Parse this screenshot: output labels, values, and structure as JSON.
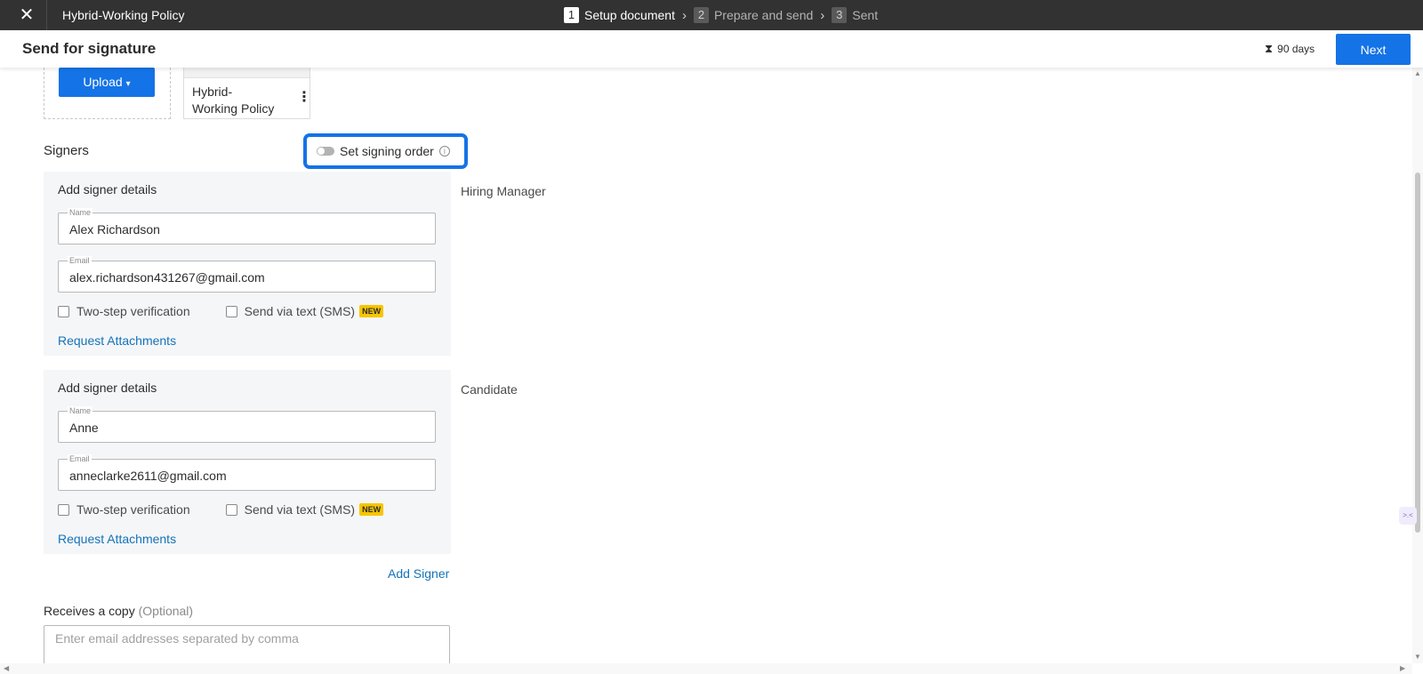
{
  "topbar": {
    "close_icon": "close-icon",
    "document_title": "Hybrid-Working Policy",
    "steps": [
      {
        "number": "1",
        "label": "Setup document",
        "state": "active"
      },
      {
        "number": "2",
        "label": "Prepare and send",
        "state": "inactive"
      },
      {
        "number": "3",
        "label": "Sent",
        "state": "inactive"
      }
    ],
    "chevron": "›"
  },
  "header": {
    "title": "Send for signature",
    "expiry_icon": "hourglass-icon",
    "expiry_text": "90 days",
    "next_label": "Next"
  },
  "upload": {
    "button_label": "Upload",
    "caret": "▾"
  },
  "document_card": {
    "name_line1": "Hybrid-",
    "name_line2": "Working Policy",
    "more_icon": "⋮"
  },
  "signers": {
    "heading": "Signers",
    "signing_order_label": "Set signing order",
    "signing_order_enabled": false,
    "info_glyph": "i",
    "list": [
      {
        "card_title": "Add signer details",
        "role": "Hiring Manager",
        "name_label": "Name",
        "name_value": "Alex Richardson",
        "email_label": "Email",
        "email_value": "alex.richardson431267@gmail.com",
        "two_step_label": "Two-step verification",
        "sms_label": "Send via text (SMS)",
        "new_badge": "NEW",
        "request_attachments": "Request Attachments"
      },
      {
        "card_title": "Add signer details",
        "role": "Candidate",
        "name_label": "Name",
        "name_value": "Anne",
        "email_label": "Email",
        "email_value": "anneclarke2611@gmail.com",
        "two_step_label": "Two-step verification",
        "sms_label": "Send via text (SMS)",
        "new_badge": "NEW",
        "request_attachments": "Request Attachments"
      }
    ],
    "add_signer_label": "Add Signer"
  },
  "copy": {
    "label": "Receives a copy",
    "optional": "(Optional)",
    "placeholder": "Enter email addresses separated by comma"
  },
  "colors": {
    "accent": "#1473e6",
    "link": "#1473b9",
    "topbar": "#323232",
    "badge": "#f7c500"
  }
}
